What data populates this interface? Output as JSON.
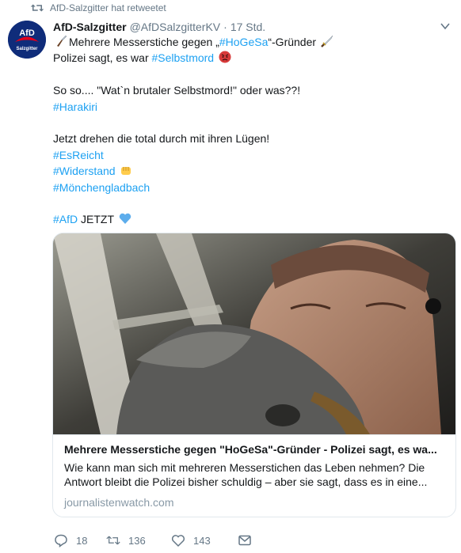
{
  "retweet_context": {
    "text": "AfD-Salzgitter hat retweetet"
  },
  "tweet": {
    "author_name": "AfD-Salzgitter",
    "author_handle": "@AfDSalzgitterKV",
    "separator": "·",
    "time": "17 Std.",
    "lines": {
      "l1_pre": "Mehrere Messerstiche gegen „",
      "l1_tag": "#HoGeSa",
      "l1_post": "“-Gründer",
      "l2_pre": "Polizei sagt, es war ",
      "l2_tag": "#Selbstmord",
      "l3": "So so.... \"Wat`n brutaler Selbstmord!\"  oder was??!",
      "l4_tag": "#Harakiri",
      "l5": "Jetzt drehen die total durch mit ihren Lügen!",
      "l6_tag": "#EsReicht",
      "l7_tag": "#Widerstand",
      "l8_tag": "#Mönchengladbach",
      "l9_tag": "#AfD",
      "l9_post": " JETZT"
    }
  },
  "card": {
    "title": "Mehrere Messerstiche gegen \"HoGeSa\"-Gründer - Polizei sagt, es wa...",
    "description": "Wie kann man sich mit mehreren Messerstichen das Leben nehmen? Die Antwort bleibt die Polizei bisher schuldig – aber sie sagt, dass es in eine...",
    "domain": "journalistenwatch.com"
  },
  "actions": {
    "reply_count": "18",
    "retweet_count": "136",
    "like_count": "143"
  },
  "avatar_text": {
    "top": "AfD",
    "bottom": "Salzgitter"
  },
  "colors": {
    "link": "#1da1f2",
    "muted": "#657786",
    "avatar_bg": "#0f2c7a",
    "accent_red": "#e3001b"
  },
  "icons": [
    "retweet-icon",
    "knife-icon",
    "angry-face-icon",
    "dagger-icon",
    "fist-icon",
    "blue-heart-icon",
    "chevron-down-icon",
    "reply-icon",
    "like-icon",
    "message-icon"
  ]
}
